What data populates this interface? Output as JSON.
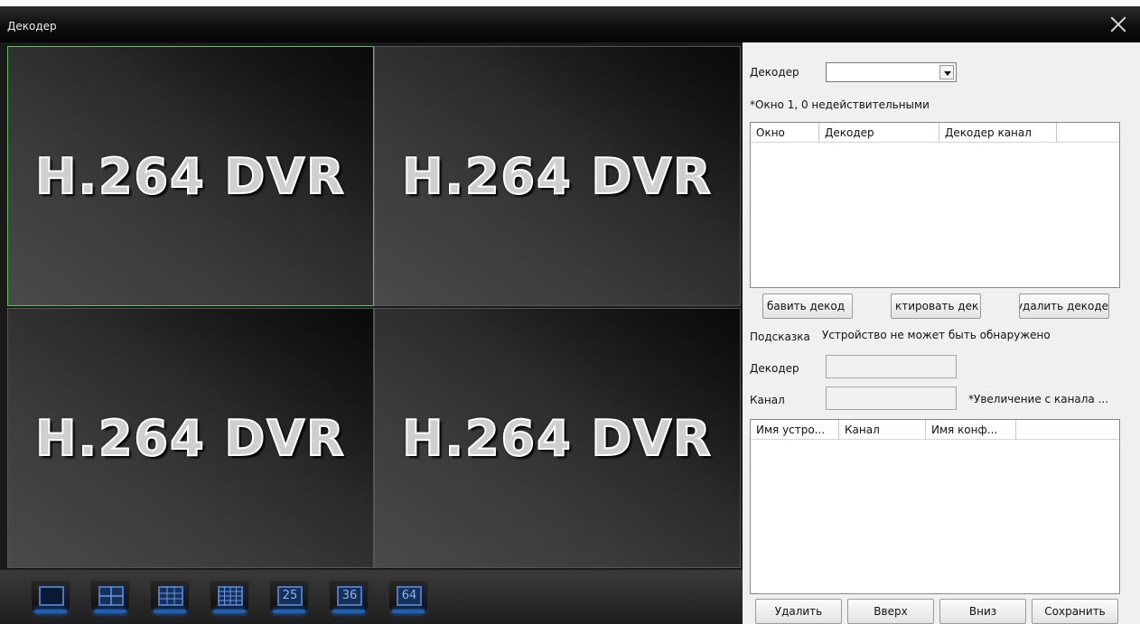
{
  "window": {
    "title": "Декодер",
    "close_icon": "close-icon"
  },
  "video": {
    "cells": [
      {
        "label": "H.264 DVR"
      },
      {
        "label": "H.264 DVR"
      },
      {
        "label": "H.264 DVR"
      },
      {
        "label": "H.264 DVR"
      }
    ],
    "selected_cell": 0,
    "layout_buttons": [
      {
        "icon": "layout-1-icon"
      },
      {
        "icon": "layout-4-icon"
      },
      {
        "icon": "layout-9-icon"
      },
      {
        "icon": "layout-16-icon"
      },
      {
        "label": "25"
      },
      {
        "label": "36"
      },
      {
        "label": "64"
      }
    ]
  },
  "panel": {
    "decoder_label": "Декодер",
    "decoder_value": "",
    "window_info": "*Окно 1, 0 недействительными",
    "table1": {
      "columns": [
        "Окно",
        "Декодер",
        "Декодер канал"
      ]
    },
    "buttons": {
      "add": "бавить декод",
      "edit": "ктировать дек",
      "delete_decoder": "удалить декоде"
    },
    "hint_label": "Подсказка",
    "hint_text": "Устройство не может быть обнаружено",
    "decoder_field_label": "Декодер",
    "channel_field_label": "Канал",
    "channel_note": "*Увеличение с канала ...",
    "table2": {
      "columns": [
        "Имя устро...",
        "Канал",
        "Имя конф..."
      ]
    },
    "bottom_buttons": {
      "delete": "Удалить",
      "up": "Вверх",
      "down": "Вниз",
      "save": "Сохранить"
    }
  },
  "colors": {
    "selection_border": "#5dc35d",
    "toolbar_accent": "#1e5fb8"
  }
}
